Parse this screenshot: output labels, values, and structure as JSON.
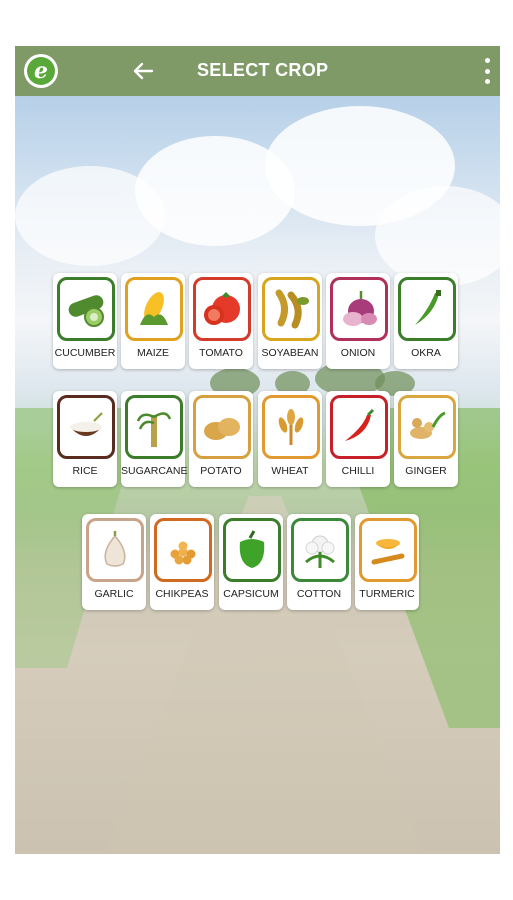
{
  "app": {
    "logo_letter": "e"
  },
  "header": {
    "title": "SELECT CROP",
    "back_icon": "arrow-left-icon",
    "menu_icon": "more-vert-icon"
  },
  "crops_row1": [
    {
      "label": "CUCUMBER",
      "icon": "cucumber-icon",
      "border": "#3b7d2a"
    },
    {
      "label": "MAIZE",
      "icon": "maize-icon",
      "border": "#e0a020"
    },
    {
      "label": "TOMATO",
      "icon": "tomato-icon",
      "border": "#d23b2a"
    },
    {
      "label": "SOYABEAN",
      "icon": "soyabean-icon",
      "border": "#d8a520"
    },
    {
      "label": "ONION",
      "icon": "onion-icon",
      "border": "#b0305a"
    },
    {
      "label": "OKRA",
      "icon": "okra-icon",
      "border": "#3b7d2a"
    }
  ],
  "crops_row2": [
    {
      "label": "RICE",
      "icon": "rice-icon",
      "border": "#5a2c20"
    },
    {
      "label": "SUGARCANE",
      "icon": "sugarcane-icon",
      "border": "#3b7d2a"
    },
    {
      "label": "POTATO",
      "icon": "potato-icon",
      "border": "#d6a040"
    },
    {
      "label": "WHEAT",
      "icon": "wheat-icon",
      "border": "#e09a30"
    },
    {
      "label": "CHILLI",
      "icon": "chilli-icon",
      "border": "#c8202a"
    },
    {
      "label": "GINGER",
      "icon": "ginger-icon",
      "border": "#d9a640"
    }
  ],
  "crops_row3": [
    {
      "label": "GARLIC",
      "icon": "garlic-icon",
      "border": "#c8a58a"
    },
    {
      "label": "CHIKPEAS",
      "icon": "chikpeas-icon",
      "border": "#d06a20"
    },
    {
      "label": "CAPSICUM",
      "icon": "capsicum-icon",
      "border": "#3b7d2a"
    },
    {
      "label": "COTTON",
      "icon": "cotton-icon",
      "border": "#3b8a3a"
    },
    {
      "label": "TURMERIC",
      "icon": "turmeric-icon",
      "border": "#e09a30"
    }
  ]
}
